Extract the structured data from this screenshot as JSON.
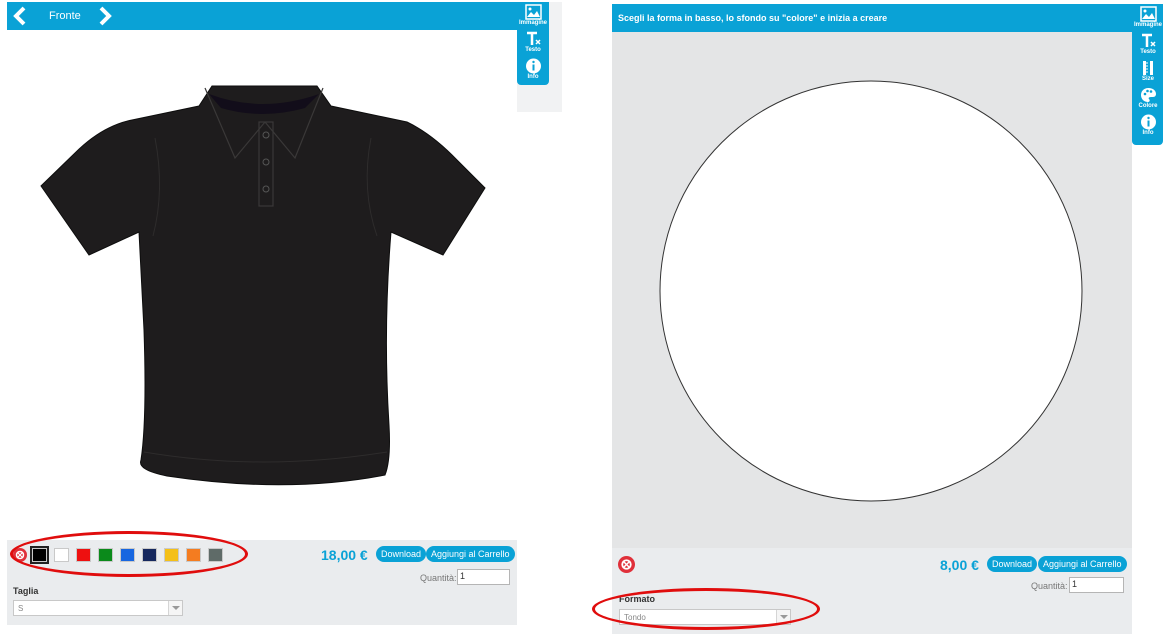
{
  "left": {
    "header": {
      "prev_icon": "chevron-left-icon",
      "next_icon": "chevron-right-icon",
      "view_label": "Fronte"
    },
    "tools": [
      {
        "label": "Immagine",
        "icon": "image-icon"
      },
      {
        "label": "Testo",
        "icon": "text-icon"
      },
      {
        "label": "Info",
        "icon": "info-icon"
      }
    ],
    "product": {
      "name": "polo shirt",
      "color": "#1e1c1d"
    },
    "footer": {
      "reset_icon": "reset-icon",
      "swatches": [
        {
          "name": "black",
          "color": "#000000"
        },
        {
          "name": "white",
          "color": "#ffffff"
        },
        {
          "name": "red",
          "color": "#ee1010"
        },
        {
          "name": "green",
          "color": "#0b8a1b"
        },
        {
          "name": "blue",
          "color": "#1766e0"
        },
        {
          "name": "navy",
          "color": "#16285e"
        },
        {
          "name": "yellow",
          "color": "#f4c018"
        },
        {
          "name": "orange",
          "color": "#f47c20"
        },
        {
          "name": "grey-melange",
          "color": "#5f6b68"
        }
      ],
      "selected_color": "black",
      "price": "18,00 €",
      "download_label": "Download",
      "add_to_cart_label": "Aggiungi al Carrello",
      "quantity_label": "Quantità:",
      "quantity_value": "1",
      "size_label": "Taglia",
      "size_value": "S"
    }
  },
  "right": {
    "header": {
      "instruction": "Scegli la forma in basso, lo sfondo su \"colore\" e inizia a creare"
    },
    "tools": [
      {
        "label": "Immagine",
        "icon": "image-icon"
      },
      {
        "label": "Testo",
        "icon": "text-icon"
      },
      {
        "label": "Size",
        "icon": "ruler-icon"
      },
      {
        "label": "Colore",
        "icon": "palette-icon"
      },
      {
        "label": "Info",
        "icon": "info-icon"
      }
    ],
    "canvas": {
      "shape": "circle",
      "background": "#e4e5e6",
      "fill": "#ffffff"
    },
    "footer": {
      "reset_icon": "reset-icon",
      "price": "8,00 €",
      "download_label": "Download",
      "add_to_cart_label": "Aggiungi al Carrello",
      "quantity_label": "Quantità:",
      "quantity_value": "1",
      "format_label": "Formato",
      "format_value": "Tondo"
    }
  },
  "colors": {
    "accent": "#0aa2d6",
    "annotation": "#e00d0d",
    "panel_bg": "#eaecee"
  }
}
